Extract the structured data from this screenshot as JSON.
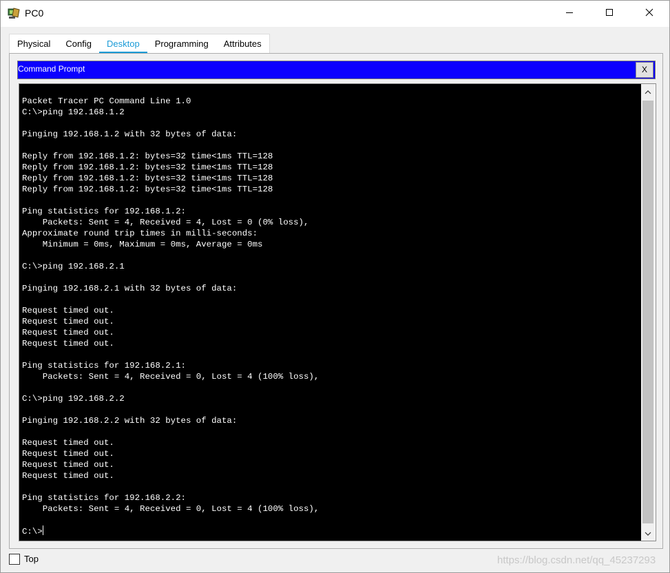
{
  "window": {
    "title": "PC0",
    "app_icon": "packet-tracer-pc-icon",
    "controls": {
      "minimize_icon": "minimize-icon",
      "maximize_icon": "maximize-icon",
      "close_icon": "close-icon"
    }
  },
  "tabs": [
    {
      "label": "Physical",
      "active": false
    },
    {
      "label": "Config",
      "active": false
    },
    {
      "label": "Desktop",
      "active": true
    },
    {
      "label": "Programming",
      "active": false
    },
    {
      "label": "Attributes",
      "active": false
    }
  ],
  "command_prompt": {
    "title": "Command Prompt",
    "close_label": "X",
    "lines": [
      "Packet Tracer PC Command Line 1.0",
      "C:\\>ping 192.168.1.2",
      "",
      "Pinging 192.168.1.2 with 32 bytes of data:",
      "",
      "Reply from 192.168.1.2: bytes=32 time<1ms TTL=128",
      "Reply from 192.168.1.2: bytes=32 time<1ms TTL=128",
      "Reply from 192.168.1.2: bytes=32 time<1ms TTL=128",
      "Reply from 192.168.1.2: bytes=32 time<1ms TTL=128",
      "",
      "Ping statistics for 192.168.1.2:",
      "    Packets: Sent = 4, Received = 4, Lost = 0 (0% loss),",
      "Approximate round trip times in milli-seconds:",
      "    Minimum = 0ms, Maximum = 0ms, Average = 0ms",
      "",
      "C:\\>ping 192.168.2.1",
      "",
      "Pinging 192.168.2.1 with 32 bytes of data:",
      "",
      "Request timed out.",
      "Request timed out.",
      "Request timed out.",
      "Request timed out.",
      "",
      "Ping statistics for 192.168.2.1:",
      "    Packets: Sent = 4, Received = 0, Lost = 4 (100% loss),",
      "",
      "C:\\>ping 192.168.2.2",
      "",
      "Pinging 192.168.2.2 with 32 bytes of data:",
      "",
      "Request timed out.",
      "Request timed out.",
      "Request timed out.",
      "Request timed out.",
      "",
      "Ping statistics for 192.168.2.2:",
      "    Packets: Sent = 4, Received = 0, Lost = 4 (100% loss),",
      ""
    ],
    "prompt": "C:\\>"
  },
  "footer": {
    "top_label": "Top",
    "top_checked": false,
    "watermark": "https://blog.csdn.net/qq_45237293"
  },
  "colors": {
    "accent": "#1b9bd7",
    "cp_header": "#0b00ff",
    "terminal_bg": "#000000",
    "terminal_fg": "#ffffff"
  }
}
